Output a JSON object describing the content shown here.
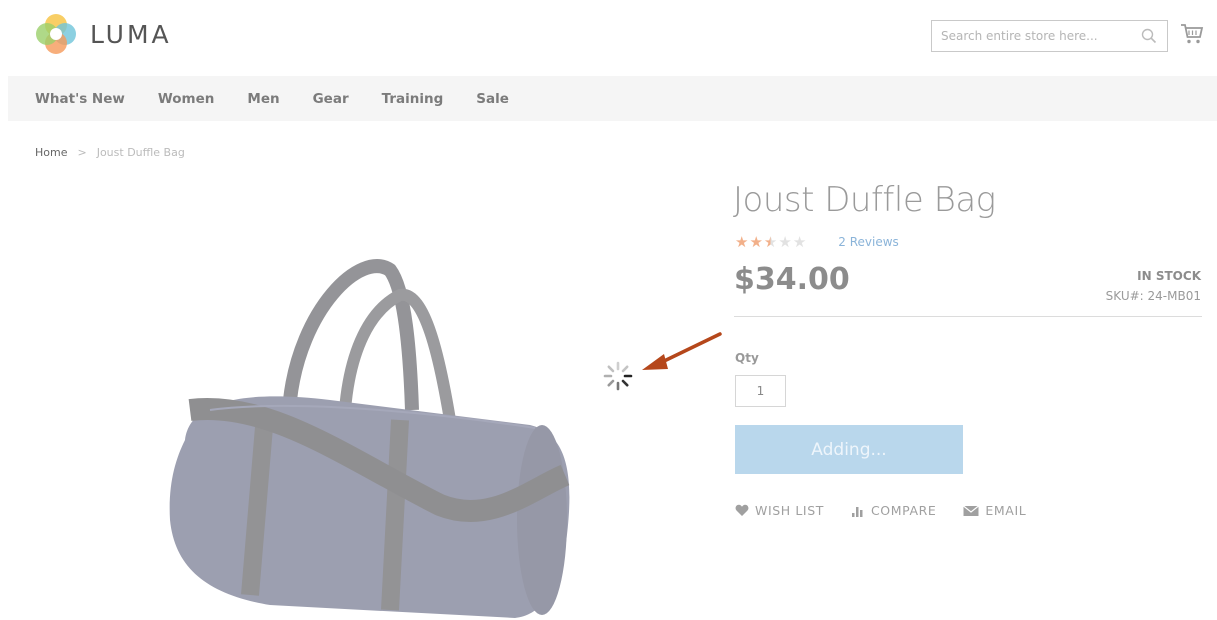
{
  "header": {
    "logo_text": "LUMA",
    "search_placeholder": "Search entire store here..."
  },
  "nav": {
    "items": [
      "What's New",
      "Women",
      "Men",
      "Gear",
      "Training",
      "Sale"
    ]
  },
  "breadcrumb": {
    "home": "Home",
    "separator": ">",
    "current": "Joust Duffle Bag"
  },
  "product": {
    "title": "Joust Duffle Bag",
    "rating": {
      "stars_total": 5,
      "stars_value": 2.5,
      "reviews_link": "2 Reviews"
    },
    "price": "$34.00",
    "stock": "IN STOCK",
    "sku_label": "SKU#:",
    "sku_value": "24-MB01",
    "qty_label": "Qty",
    "qty_value": "1",
    "add_button_label": "Adding...",
    "actions": {
      "wishlist": "WISH LIST",
      "compare": "COMPARE",
      "email": "EMAIL"
    }
  },
  "colors": {
    "accent_orange": "#f2b08a",
    "button_blue": "#b9d7ec",
    "link_blue": "#8bb4d9",
    "annotation_arrow": "#b5471b"
  },
  "icons": {
    "search": "search-icon",
    "cart": "cart-icon",
    "spinner": "loading-spinner-icon",
    "wishlist": "heart-icon",
    "compare": "compare-bars-icon",
    "email": "envelope-icon"
  }
}
